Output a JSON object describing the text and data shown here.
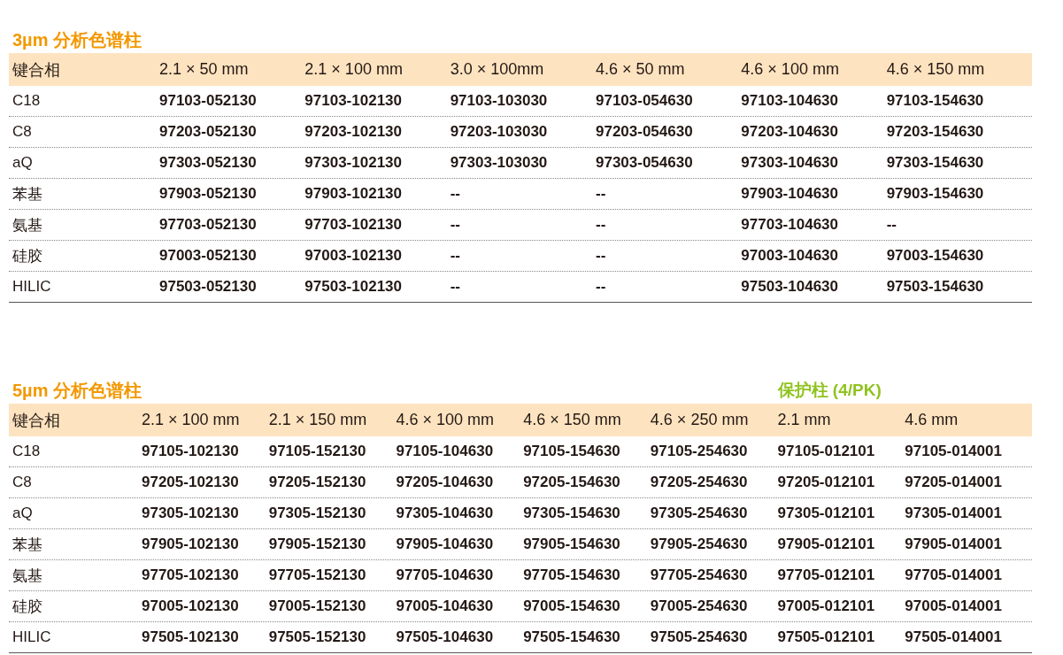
{
  "tables": [
    {
      "title": "3µm 分析色谱柱",
      "columns": [
        "键合相",
        "2.1 × 50 mm",
        "2.1 × 100 mm",
        "3.0 × 100mm",
        "4.6 × 50 mm",
        "4.6 × 100 mm",
        "4.6 × 150 mm"
      ],
      "rows": [
        [
          "C18",
          "97103-052130",
          "97103-102130",
          "97103-103030",
          "97103-054630",
          "97103-104630",
          "97103-154630"
        ],
        [
          "C8",
          "97203-052130",
          "97203-102130",
          "97203-103030",
          "97203-054630",
          "97203-104630",
          "97203-154630"
        ],
        [
          "aQ",
          "97303-052130",
          "97303-102130",
          "97303-103030",
          "97303-054630",
          "97303-104630",
          "97303-154630"
        ],
        [
          "苯基",
          "97903-052130",
          "97903-102130",
          "--",
          "--",
          "97903-104630",
          "97903-154630"
        ],
        [
          "氨基",
          "97703-052130",
          "97703-102130",
          "--",
          "--",
          "97703-104630",
          "--"
        ],
        [
          "硅胶",
          "97003-052130",
          "97003-102130",
          "--",
          "--",
          "97003-104630",
          "97003-154630"
        ],
        [
          "HILIC",
          "97503-052130",
          "97503-102130",
          "--",
          "--",
          "97503-104630",
          "97503-154630"
        ]
      ]
    },
    {
      "title": "5µm 分析色谱柱",
      "guard_title": "保护柱 (4/PK)",
      "columns": [
        "键合相",
        "2.1 × 100 mm",
        "2.1 × 150 mm",
        "4.6 × 100 mm",
        "4.6 × 150 mm",
        "4.6 × 250 mm",
        "2.1 mm",
        "4.6 mm"
      ],
      "rows": [
        [
          "C18",
          "97105-102130",
          "97105-152130",
          "97105-104630",
          "97105-154630",
          "97105-254630",
          "97105-012101",
          "97105-014001"
        ],
        [
          "C8",
          "97205-102130",
          "97205-152130",
          "97205-104630",
          "97205-154630",
          "97205-254630",
          "97205-012101",
          "97205-014001"
        ],
        [
          "aQ",
          "97305-102130",
          "97305-152130",
          "97305-104630",
          "97305-154630",
          "97305-254630",
          "97305-012101",
          "97305-014001"
        ],
        [
          "苯基",
          "97905-102130",
          "97905-152130",
          "97905-104630",
          "97905-154630",
          "97905-254630",
          "97905-012101",
          "97905-014001"
        ],
        [
          "氨基",
          "97705-102130",
          "97705-152130",
          "97705-104630",
          "97705-154630",
          "97705-254630",
          "97705-012101",
          "97705-014001"
        ],
        [
          "硅胶",
          "97005-102130",
          "97005-152130",
          "97005-104630",
          "97005-154630",
          "97005-254630",
          "97005-012101",
          "97005-014001"
        ],
        [
          "HILIC",
          "97505-102130",
          "97505-152130",
          "97505-104630",
          "97505-154630",
          "97505-254630",
          "97505-012101",
          "97505-014001"
        ]
      ]
    }
  ]
}
